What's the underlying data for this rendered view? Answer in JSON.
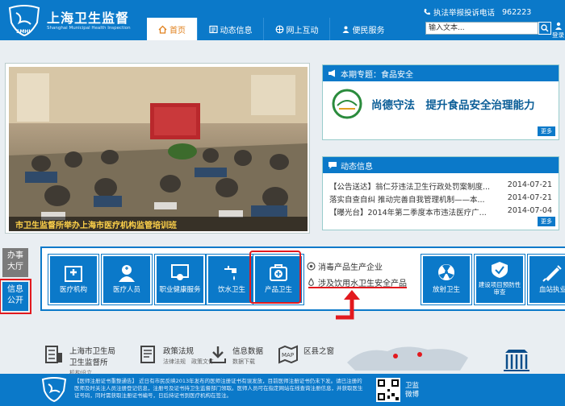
{
  "header": {
    "logo_cn": "上海卫生监督",
    "logo_en": "Shanghai Municipal Health Inspection",
    "logo_badge": "SMHI",
    "hotline_label": "执法举报投诉电话",
    "hotline_number": "962223",
    "search_placeholder": "输入文本...",
    "login_label": "登录"
  },
  "nav": [
    {
      "label": "首页",
      "icon": "home-icon"
    },
    {
      "label": "动态信息",
      "icon": "news-icon"
    },
    {
      "label": "网上互动",
      "icon": "globe-icon"
    },
    {
      "label": "便民服务",
      "icon": "people-icon"
    }
  ],
  "hero": {
    "caption": "市卫生监督所举办上海市医疗机构监管培训班"
  },
  "topic": {
    "header": "本期专题：食品安全",
    "banner_text": "尚德守法　提升食品安全治理能力",
    "more": "更多"
  },
  "news": {
    "header": "动态信息",
    "items": [
      {
        "title": "【公告送达】翁仁芬违法卫生行政处罚案制度...",
        "date": "2014-07-21"
      },
      {
        "title": "落实自查自纠 推动完善自我管理机制——本...",
        "date": "2014-07-21"
      },
      {
        "title": "【曝光台】2014年第二季度本市违法医疗广...",
        "date": "2014-07-04"
      }
    ],
    "more": "更多"
  },
  "side_tabs": [
    {
      "label": "办事大厅",
      "line1": "办事",
      "line2": "大厅"
    },
    {
      "label": "信息公开",
      "line1": "信息",
      "line2": "公开"
    }
  ],
  "services": [
    {
      "label": "医疗机构",
      "icon": "hospital-icon"
    },
    {
      "label": "医疗人员",
      "icon": "nurse-icon"
    },
    {
      "label": "职业健康服务",
      "icon": "certificate-icon"
    },
    {
      "label": "饮水卫生",
      "icon": "faucet-icon"
    },
    {
      "label": "产品卫生",
      "icon": "medkit-icon"
    },
    {
      "label": "放射卫生",
      "icon": "radiation-icon"
    },
    {
      "label": "建设项目预防性审查",
      "icon": "shield-icon"
    },
    {
      "label": "血站执业",
      "icon": "syringe-icon"
    }
  ],
  "product_sub": [
    {
      "label": "消毒产品生产企业"
    },
    {
      "label": "涉及饮用水卫生安全产品"
    }
  ],
  "footer_links": [
    {
      "title": "上海市卫生局",
      "title2": "卫生监督所",
      "sub": "机构设立"
    },
    {
      "title": "政策法规",
      "sub": "法律法规　政策文件"
    },
    {
      "title": "信息数据",
      "sub": "数据下载"
    },
    {
      "title": "区县之窗",
      "sub": ""
    }
  ],
  "footer": {
    "text": "【医师注册证书重整通告】 近日有市民反映2013年发布的医师注册证书有误发放，目前医师注册证书仍未下发。请已注册的医师及时关注人员注册登记信息，注册号及证书持卫生监督部门领取。医师人员可在指定网站在线查询注册信息，并获取医生证号码，同时需获取注册证书编号，日后持证书到医疗机构在签注。",
    "qr_label": "卫监微博"
  }
}
